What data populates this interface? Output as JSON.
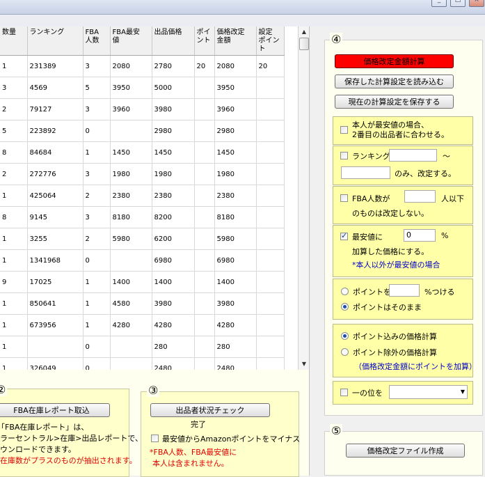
{
  "window": {
    "minimize": "_",
    "maximize": "□",
    "close": "×"
  },
  "grid": {
    "headers": [
      "数量",
      "ランキング",
      "FBA\n人数",
      "FBA最安\n値",
      "出品価格",
      "ポイ\nント",
      "価格改定\n金額",
      "設定\nポイン\nト"
    ],
    "rows": [
      [
        "1",
        "231389",
        "3",
        "2080",
        "2780",
        "20",
        "2080",
        "20"
      ],
      [
        "3",
        "4569",
        "5",
        "3950",
        "5000",
        "",
        "3950",
        ""
      ],
      [
        "2",
        "79127",
        "3",
        "3960",
        "3980",
        "",
        "3960",
        ""
      ],
      [
        "5",
        "223892",
        "0",
        "",
        "2980",
        "",
        "2980",
        ""
      ],
      [
        "8",
        "84684",
        "1",
        "1450",
        "1450",
        "",
        "1450",
        ""
      ],
      [
        "2",
        "272776",
        "3",
        "1980",
        "1980",
        "",
        "1980",
        ""
      ],
      [
        "1",
        "425064",
        "2",
        "2380",
        "2380",
        "",
        "2380",
        ""
      ],
      [
        "8",
        "9145",
        "3",
        "8180",
        "8200",
        "",
        "8180",
        ""
      ],
      [
        "1",
        "3255",
        "2",
        "5980",
        "6200",
        "",
        "5980",
        ""
      ],
      [
        "1",
        "1341968",
        "0",
        "",
        "6980",
        "",
        "6980",
        ""
      ],
      [
        "9",
        "17025",
        "1",
        "1400",
        "1400",
        "",
        "1400",
        ""
      ],
      [
        "1",
        "850641",
        "1",
        "4580",
        "3980",
        "",
        "3980",
        ""
      ],
      [
        "1",
        "673956",
        "1",
        "4280",
        "4280",
        "",
        "4280",
        ""
      ],
      [
        "1",
        "",
        "0",
        "",
        "280",
        "",
        "280",
        ""
      ],
      [
        "1",
        "326049",
        "0",
        "",
        "2480",
        "",
        "2480",
        ""
      ]
    ],
    "scroll_up": "▲",
    "scroll_down": "▼"
  },
  "panel2": {
    "number": "②",
    "button": "FBA在庫レポート取込",
    "line1": "「FBA在庫レポート」は、",
    "line2": "ラーセントラル>在庫>出品レポートで、",
    "line3": "ウンロードできます。",
    "line4": "在庫数がプラスのものが抽出されます。"
  },
  "panel3": {
    "number": "③",
    "button": "出品者状況チェック",
    "status": "完了",
    "checkbox_label": "最安値からAmazonポイントをマイナス",
    "note1": "*FBA人数、FBA最安値に",
    "note2": "本人は含まれません。"
  },
  "panel4": {
    "number": "④",
    "calc_button": "価格改定金額計算",
    "load_button": "保存した計算設定を読み込む",
    "save_button": "現在の計算設定を保存する",
    "match_second": {
      "line1": "本人が最安値の場合、",
      "line2": "2番目の出品者に合わせる。",
      "checked": false
    },
    "ranking": {
      "label": "ランキング",
      "tilde": "～",
      "suffix": "のみ、改定する。",
      "from_value": "",
      "to_value": "",
      "checked": false
    },
    "fba_count": {
      "label": "FBA人数が",
      "suffix": "人以下",
      "line2": "のものは改定しない。",
      "value": "",
      "checked": false
    },
    "lowest": {
      "label": "最安値に",
      "value": "0",
      "percent": "%",
      "line2": "加算した価格にする。",
      "note": "*本人以外が最安値の場合",
      "checked": true
    },
    "point_option1": {
      "label": "ポイントを",
      "suffix": "%つける",
      "value": "",
      "selected": false
    },
    "point_option2": {
      "label": "ポイントはそのまま",
      "selected": true
    },
    "calc_option1": {
      "label": "ポイント込みの価格計算",
      "selected": true
    },
    "calc_option2": {
      "label": "ポイント除外の価格計算",
      "note": "（価格改定金額にポイントを加算）",
      "selected": false
    },
    "ones_place": {
      "label": "一の位を",
      "value": "",
      "checked": false,
      "arrow": "▼"
    }
  },
  "panel5": {
    "number": "⑤",
    "button": "価格改定ファイル作成"
  },
  "colors": {
    "calc_button_bg": "#ff0000",
    "yellow_panel": "#ffffa8",
    "red_text": "#e00000",
    "blue_text": "#0000c8"
  }
}
